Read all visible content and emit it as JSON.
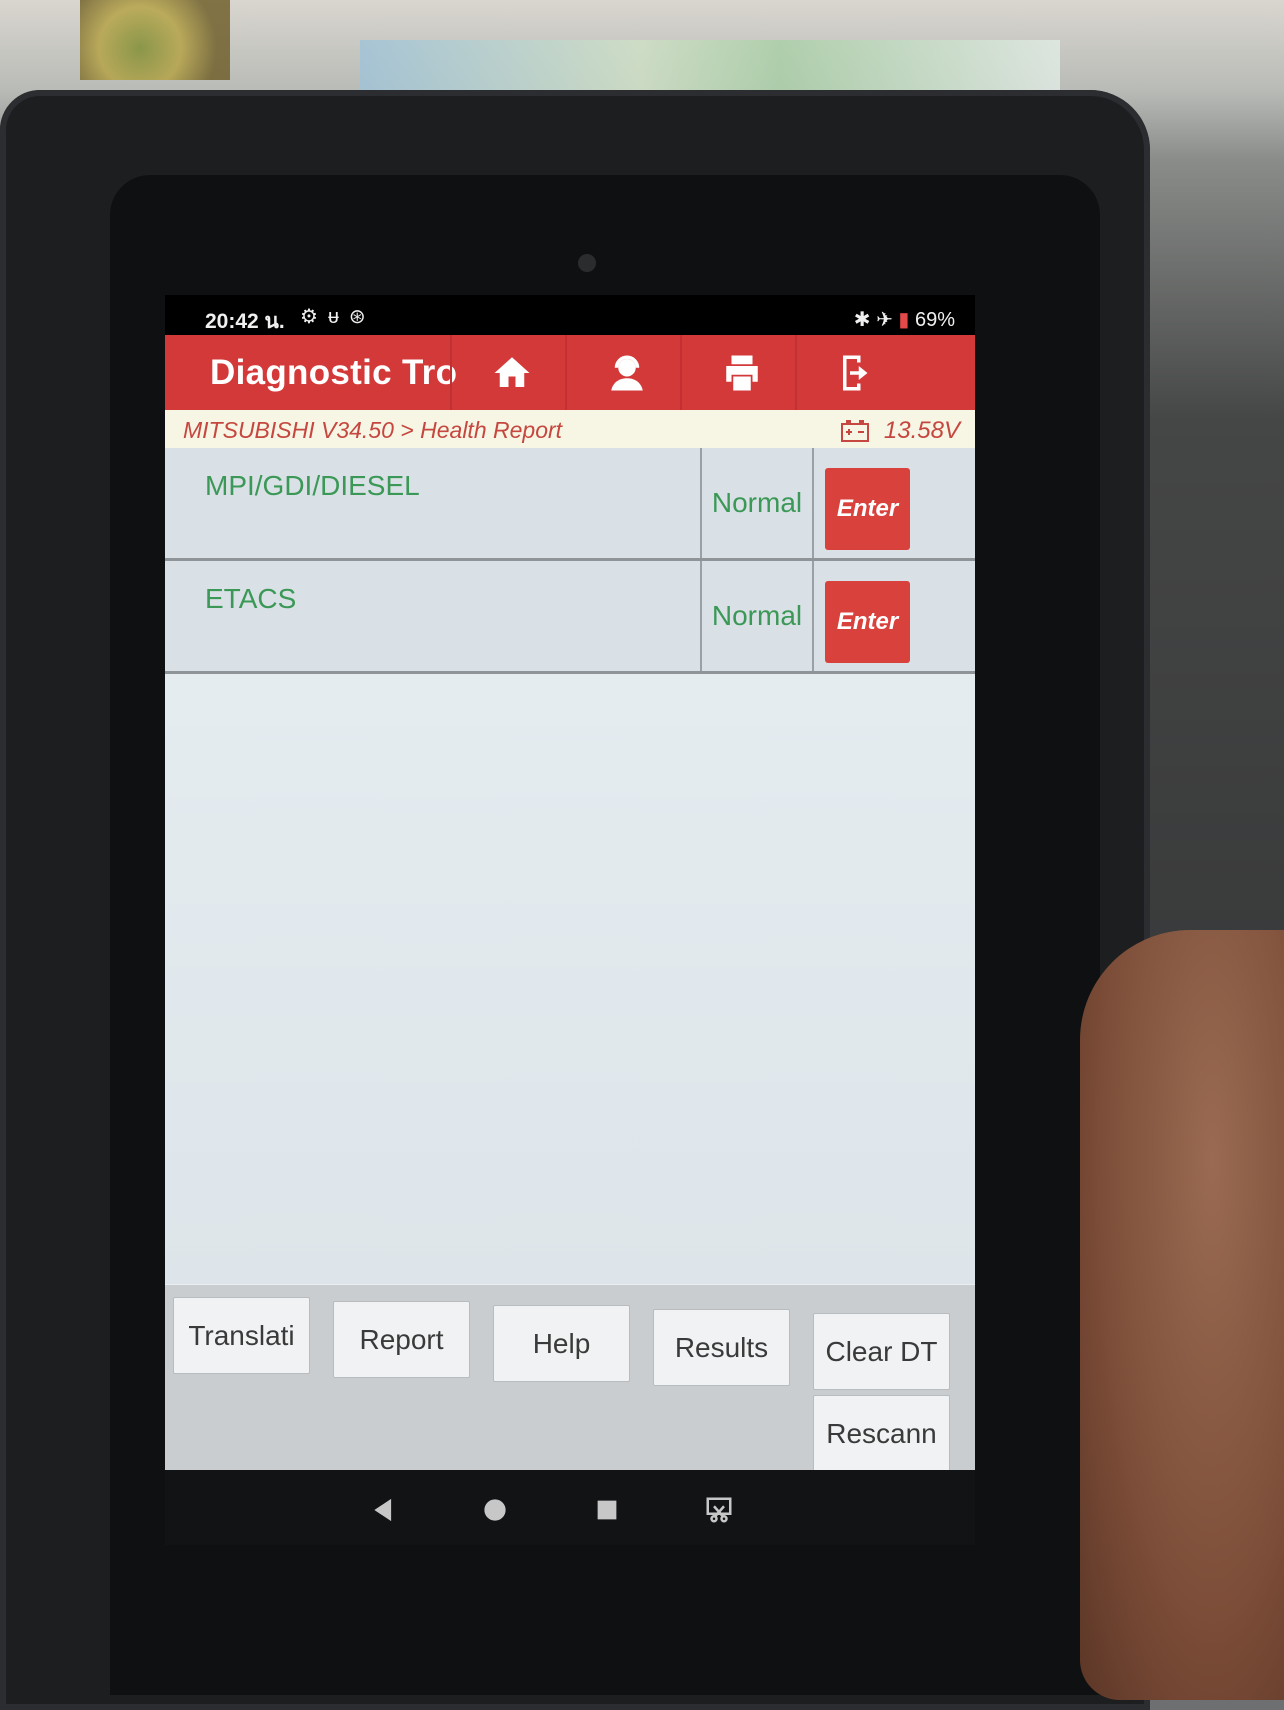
{
  "status_bar": {
    "time": "20:42 น.",
    "left_icons": [
      "gear-icon",
      "stethoscope-icon",
      "car-diag-icon"
    ],
    "right_icons": [
      "bluetooth-icon",
      "airplane-icon",
      "battery-icon"
    ],
    "battery": "69%"
  },
  "header": {
    "title": "Diagnostic Tro",
    "buttons": [
      "home-icon",
      "support-agent-icon",
      "printer-icon",
      "exit-icon"
    ]
  },
  "breadcrumb": {
    "path": "MITSUBISHI V34.50 > Health Report",
    "voltage": "13.58V"
  },
  "systems": [
    {
      "name": "MPI/GDI/DIESEL",
      "status": "Normal",
      "action": "Enter"
    },
    {
      "name": "ETACS",
      "status": "Normal",
      "action": "Enter"
    }
  ],
  "bottom_buttons": {
    "translate": "Translati",
    "report": "Report",
    "help": "Help",
    "results": "Results",
    "clear_dtc": "Clear DT",
    "rescan": "Rescann"
  },
  "colors": {
    "header_red": "#d4393a",
    "status_green": "#3b9856",
    "breadcrumb_text": "#c5473f",
    "enter_button": "#d9413d"
  }
}
